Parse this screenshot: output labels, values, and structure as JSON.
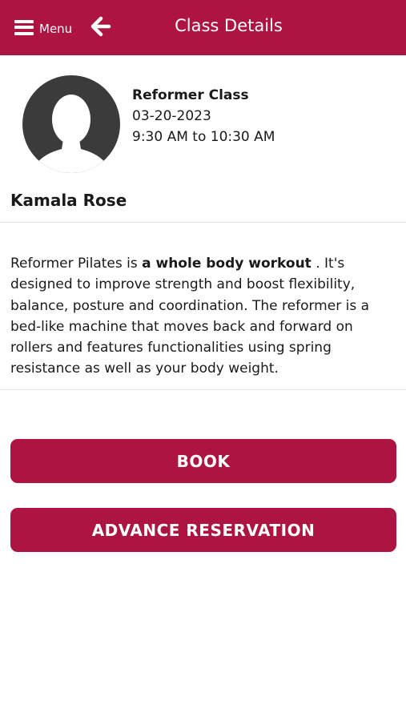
{
  "header": {
    "menu_label": "Menu",
    "title": "Class Details"
  },
  "class": {
    "name": "Reformer Class",
    "date": "03-20-2023",
    "time": "9:30 AM to 10:30 AM",
    "instructor": "Kamala Rose"
  },
  "description": {
    "before": "Reformer Pilates is ",
    "bold": "a whole body workout",
    "after": " . It's designed to improve strength and boost flexibility, balance, posture and coordination. The reformer is a bed-like machine that moves back and forward on rollers and features functionalities using spring resistance as well as your body weight."
  },
  "actions": {
    "book_label": "BOOK",
    "advance_label": "ADVANCE RESERVATION"
  },
  "colors": {
    "primary": "#ae1442",
    "avatar_bg": "#3b3b3b",
    "divider": "#e4e4e4"
  },
  "icons": {
    "menu": "hamburger-icon",
    "back": "arrow-left-icon",
    "avatar": "user-silhouette-icon"
  }
}
